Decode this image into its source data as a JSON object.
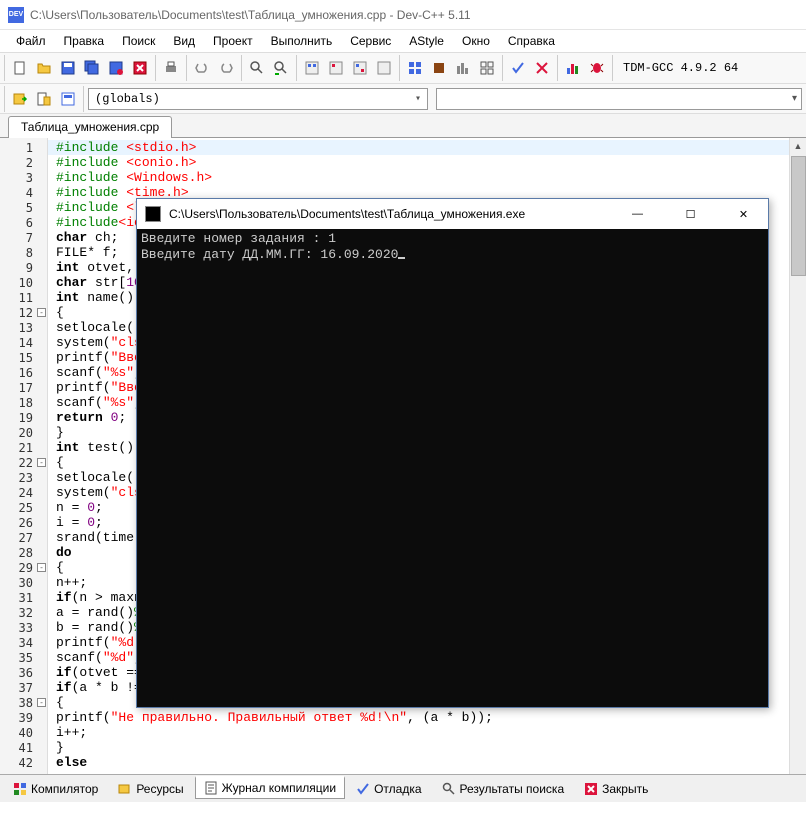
{
  "title": "C:\\Users\\Пользователь\\Documents\\test\\Таблица_умножения.cpp - Dev-C++ 5.11",
  "menu": {
    "file": "Файл",
    "edit": "Правка",
    "search": "Поиск",
    "view": "Вид",
    "project": "Проект",
    "run": "Выполнить",
    "service": "Сервис",
    "astyle": "AStyle",
    "window": "Окно",
    "help": "Справка"
  },
  "compiler_combo": "TDM-GCC 4.9.2 64",
  "globals": "(globals)",
  "tab": "Таблица_умножения.cpp",
  "code": [
    {
      "n": 1,
      "hl": true,
      "html": "<span class='pp'>#include</span> <span class='inc'>&lt;stdio.h&gt;</span>"
    },
    {
      "n": 2,
      "html": "<span class='pp'>#include</span> <span class='inc'>&lt;conio.h&gt;</span>"
    },
    {
      "n": 3,
      "html": "<span class='pp'>#include</span> <span class='inc'>&lt;Windows.h&gt;</span>"
    },
    {
      "n": 4,
      "html": "<span class='pp'>#include</span> <span class='inc'>&lt;time.h&gt;</span>"
    },
    {
      "n": 5,
      "html": "<span class='pp'>#include</span> <span class='inc'>&lt;l</span>"
    },
    {
      "n": 6,
      "html": "<span class='pp'>#include</span><span class='inc'>&lt;io</span>"
    },
    {
      "n": 7,
      "html": "<span class='ty'>char</span> ch;"
    },
    {
      "n": 8,
      "html": "FILE* f;"
    },
    {
      "n": 9,
      "html": "<span class='ty'>int</span> otvet,"
    },
    {
      "n": 10,
      "html": "<span class='ty'>char</span> str[<span class='num'>10</span>"
    },
    {
      "n": 11,
      "html": "<span class='ty'>int</span> name()"
    },
    {
      "n": 12,
      "fold": "-",
      "html": "{"
    },
    {
      "n": 13,
      "html": "setlocale("
    },
    {
      "n": 14,
      "html": "system(<span class='str'>\"cls</span>"
    },
    {
      "n": 15,
      "html": "printf(<span class='str'>\"Вве</span>"
    },
    {
      "n": 16,
      "html": "scanf(<span class='str'>\"%s\"</span>,"
    },
    {
      "n": 17,
      "html": "printf(<span class='str'>\"Вве</span>"
    },
    {
      "n": 18,
      "html": "scanf(<span class='str'>\"%s\"</span>,"
    },
    {
      "n": 19,
      "html": "<span class='kw'>return</span> <span class='num'>0</span>;"
    },
    {
      "n": 20,
      "html": "}"
    },
    {
      "n": 21,
      "html": "<span class='ty'>int</span> test()"
    },
    {
      "n": 22,
      "fold": "-",
      "html": "{"
    },
    {
      "n": 23,
      "html": "setlocale("
    },
    {
      "n": 24,
      "html": "system(<span class='str'>\"cls</span>"
    },
    {
      "n": 25,
      "html": "n = <span class='num'>0</span>;"
    },
    {
      "n": 26,
      "html": "i = <span class='num'>0</span>;"
    },
    {
      "n": 27,
      "html": "srand(time("
    },
    {
      "n": 28,
      "html": "<span class='kw'>do</span>"
    },
    {
      "n": 29,
      "fold": "-",
      "html": "{"
    },
    {
      "n": 30,
      "html": "n++;"
    },
    {
      "n": 31,
      "html": "<span class='kw'>if</span>(n &gt; maxn"
    },
    {
      "n": 32,
      "html": "a = rand()<span class='pp'>%</span>"
    },
    {
      "n": 33,
      "html": "b = rand()<span class='pp'>%</span>"
    },
    {
      "n": 34,
      "html": "printf(<span class='str'>\"%d</span>"
    },
    {
      "n": 35,
      "html": "scanf(<span class='str'>\"%d\"</span>,"
    },
    {
      "n": 36,
      "html": "<span class='kw'>if</span>(otvet =="
    },
    {
      "n": 37,
      "html": "<span class='kw'>if</span>(a * b !="
    },
    {
      "n": 38,
      "fold": "-",
      "html": "{"
    },
    {
      "n": 39,
      "html": "printf(<span class='str'>\"Не правильно. Правильный ответ %d!\\n\"</span>, (a * b));"
    },
    {
      "n": 40,
      "html": "i++;"
    },
    {
      "n": 41,
      "html": "}"
    },
    {
      "n": 42,
      "html": "<span class='kw'>else</span>"
    }
  ],
  "bottom_tabs": {
    "compiler": "Компилятор",
    "resources": "Ресурсы",
    "log": "Журнал компиляции",
    "debug": "Отладка",
    "results": "Результаты поиска",
    "close": "Закрыть"
  },
  "console": {
    "title": "C:\\Users\\Пользователь\\Documents\\test\\Таблица_умножения.exe",
    "line1": "Введите номер задания : 1",
    "line2": "Введите дату ДД.ММ.ГГ: 16.09.2020"
  }
}
